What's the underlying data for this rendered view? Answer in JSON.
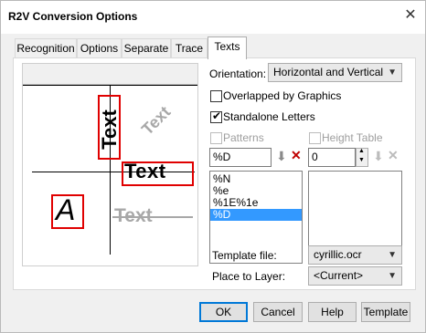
{
  "window": {
    "title": "R2V Conversion Options",
    "close_glyph": "✕"
  },
  "tabs": [
    {
      "label": "Recognition"
    },
    {
      "label": "Options"
    },
    {
      "label": "Separate"
    },
    {
      "label": "Trace"
    },
    {
      "label": "Texts"
    }
  ],
  "preview": {
    "vertical_text": "Text",
    "rotated_text": "Text",
    "horizontal_text": "Text",
    "letter": "A",
    "strike_text": "Text"
  },
  "orientation": {
    "label": "Orientation:",
    "value": "Horizontal and Vertical"
  },
  "overlapped": {
    "label": "Overlapped by Graphics",
    "checked": false
  },
  "standalone": {
    "label": "Standalone Letters",
    "checked": true
  },
  "patterns": {
    "label": "Patterns",
    "input_value": "%D",
    "items": [
      "%N",
      "%e",
      "%1E%1e",
      "%D"
    ],
    "selected": "%D"
  },
  "height_table": {
    "label": "Height Table",
    "input_value": "0"
  },
  "template_file": {
    "label": "Template file:",
    "value": "cyrillic.ocr"
  },
  "place_to_layer": {
    "label": "Place to Layer:",
    "value": "<Current>"
  },
  "buttons": {
    "ok": "OK",
    "cancel": "Cancel",
    "help": "Help",
    "template": "Template"
  },
  "colors": {
    "highlight": "#e00000",
    "selection": "#3399ff",
    "default_border": "#0078d7"
  }
}
